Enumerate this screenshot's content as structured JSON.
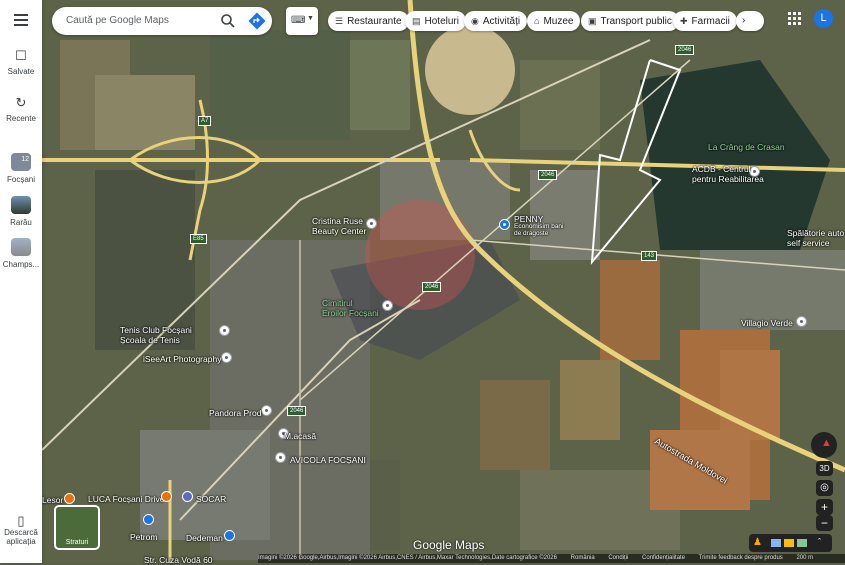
{
  "rail": {
    "saved": "Salvate",
    "recent": "Recente",
    "places": [
      {
        "label": "Focșani",
        "badge": "12"
      },
      {
        "label": "Rarău"
      },
      {
        "label": "Champs..."
      }
    ],
    "download": "Descarcă aplicația"
  },
  "search": {
    "placeholder": "Caută pe Google Maps"
  },
  "chips": [
    "Restaurante",
    "Hoteluri",
    "Activități",
    "Muzee",
    "Transport public",
    "Farmacii"
  ],
  "chip_icons": [
    "fork-knife-icon",
    "bed-icon",
    "camera-icon",
    "museum-icon",
    "bus-icon",
    "pharmacy-icon"
  ],
  "account_initial": "L",
  "map_labels": {
    "crang": "La Crâng de Crasan",
    "acdb": "ACDB - Centrul\npentru Reabilitarea",
    "penny": "PENNY",
    "penny_sub": "Economisim bani\nde dragoste",
    "cristina": "Cristina Ruse\nBeauty Center",
    "spalatorie": "Spălătorie auto\nself service",
    "cimitirul": "Cimitirul\nEroilor Focșani",
    "tenis": "Tenis Club Focșani\nȘcoala de Tenis",
    "iseeart": "iSeeArt Photography",
    "villagio": "Villagio Verde",
    "pandora": "Pandora Prod",
    "macasa": "M.acasă",
    "avicola": "AVICOLA FOCȘANI",
    "luca": "LUCA Focșani Drive",
    "socar": "SOCAR",
    "petrom": "Petrom",
    "dedeman": "Dedeman",
    "cuza": "Str. Cuza Vodă 60",
    "lesor": "Lesor",
    "autostrada": "Autostrada Moldovei",
    "road_a7": "A7",
    "road_2046": "2046",
    "road_143": "143",
    "road_e85": "E85"
  },
  "controls": {
    "three_d": "3D",
    "zoom_in": "+",
    "zoom_out": "−",
    "layers_label": "Straturi"
  },
  "brand": "Google Maps",
  "footer": {
    "attribution": "Imagini ©2026 Google,Airbus,Imagini ©2026 Airbus,CNES / Airbus,Maxar Technologies,Date cartografice ©2026",
    "country": "România",
    "terms": "Condiții",
    "privacy": "Confidențialitate",
    "feedback": "Trimite feedback despre produs",
    "scale": "200 m"
  },
  "colors": {
    "accent": "#1a73e8",
    "boundary": "#ffffff",
    "highway": "#e8d27a"
  }
}
